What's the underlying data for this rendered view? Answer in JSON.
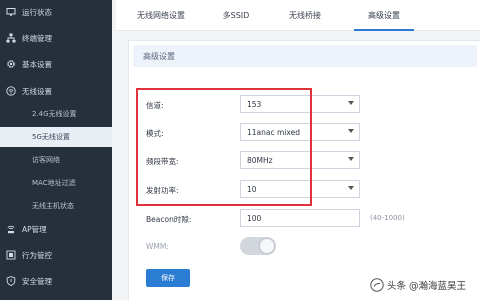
{
  "sidebar": {
    "items": [
      {
        "label": "运行状态",
        "icon": "monitor-icon"
      },
      {
        "label": "终端管理",
        "icon": "network-tree-icon"
      },
      {
        "label": "基本设置",
        "icon": "gear-icon"
      },
      {
        "label": "无线设置",
        "icon": "wifi-icon"
      }
    ],
    "subitems": [
      "2.4G无线设置",
      "5G无线设置",
      "访客网络",
      "MAC地址过滤",
      "无线主机状态"
    ],
    "bottom_items": [
      {
        "label": "AP管理",
        "icon": "ap-icon"
      },
      {
        "label": "行为管控",
        "icon": "control-icon"
      },
      {
        "label": "安全管理",
        "icon": "shield-icon"
      }
    ]
  },
  "tabs": [
    "无线网络设置",
    "多SSID",
    "无线桥接",
    "高级设置"
  ],
  "active_tab": "高级设置",
  "panel_title": "高级设置",
  "fields": {
    "channel": {
      "label": "信道:",
      "value": "153"
    },
    "mode": {
      "label": "模式:",
      "value": "11anac mixed"
    },
    "bandwidth": {
      "label": "频段带宽:",
      "value": "80MHz"
    },
    "tx_power": {
      "label": "发射功率:",
      "value": "10"
    },
    "beacon": {
      "label": "Beacon时隙:",
      "value": "100",
      "hint": "(40-1000)"
    },
    "wmm": {
      "label": "WMM:"
    }
  },
  "save_label": "保存",
  "watermark": "头条 @瀚海蓝昊王",
  "colors": {
    "sidebar_bg": "#26303d",
    "accent": "#2b7cd3",
    "highlight_box": "#e0323a"
  }
}
